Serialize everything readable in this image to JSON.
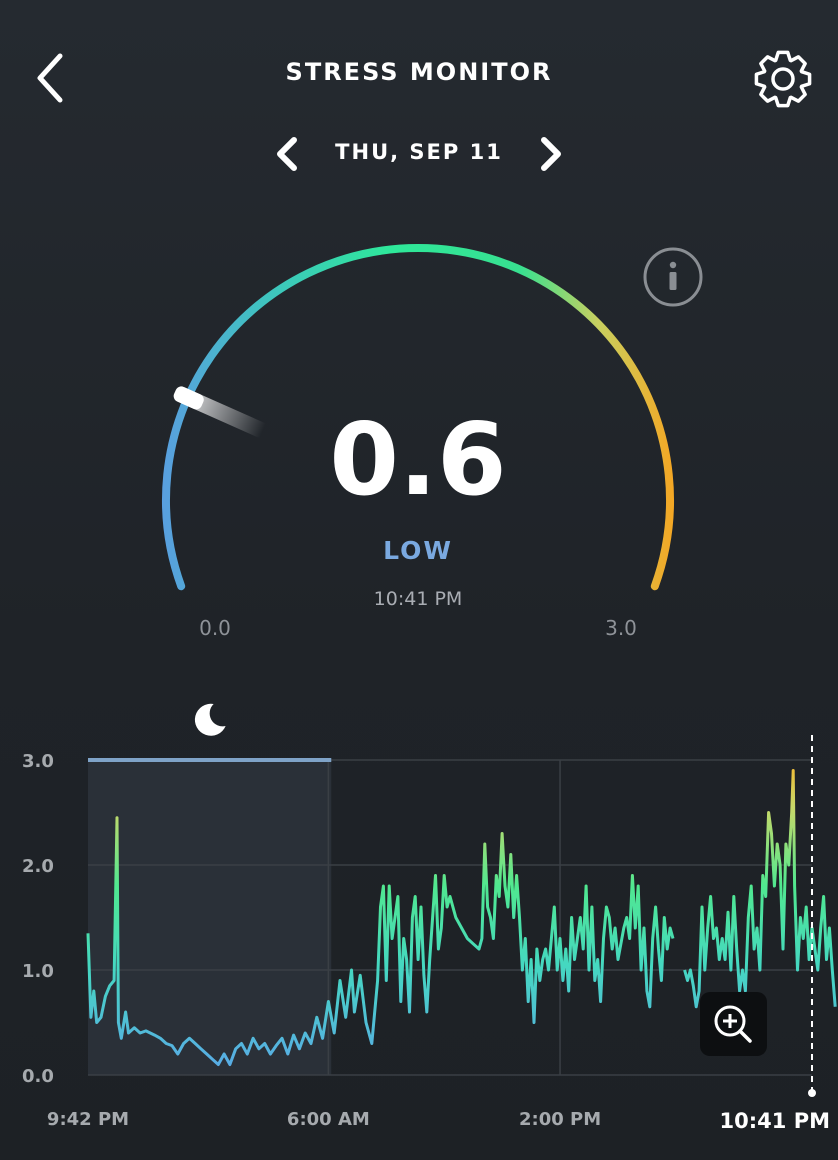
{
  "header": {
    "title": "STRESS MONITOR",
    "back_icon": "chevron-left-icon",
    "settings_icon": "gear-icon"
  },
  "date_nav": {
    "label": "THU, SEP 11",
    "prev_icon": "chevron-left-icon",
    "next_icon": "chevron-right-icon"
  },
  "gauge": {
    "value": "0.6",
    "level": "LOW",
    "time": "10:41 PM",
    "min_label": "0.0",
    "max_label": "3.0",
    "min": 0,
    "max": 3,
    "current": 0.6,
    "info_icon": "info-icon",
    "colors": {
      "low": "#5aa0e0",
      "mid": "#2ee89a",
      "high": "#f5a623",
      "level_text": "#7aa9e0"
    }
  },
  "chart_data": {
    "type": "line",
    "sleep_icon": "moon-icon",
    "zoom_icon": "zoom-in-icon",
    "ylim": [
      0,
      3
    ],
    "y_ticks": [
      "0.0",
      "1.0",
      "2.0",
      "3.0"
    ],
    "x_ticks": [
      "9:42 PM",
      "6:00 AM",
      "2:00 PM"
    ],
    "current_label": "10:41 PM",
    "x_range_hours": [
      0,
      25
    ],
    "sleep_period_hours": [
      0,
      8.4
    ],
    "grid": true,
    "series": [
      {
        "values": [
          [
            0.0,
            1.35
          ],
          [
            0.1,
            0.55
          ],
          [
            0.2,
            0.8
          ],
          [
            0.3,
            0.5
          ],
          [
            0.45,
            0.55
          ],
          [
            0.6,
            0.75
          ],
          [
            0.75,
            0.85
          ],
          [
            0.9,
            0.9
          ],
          [
            1.0,
            2.45
          ],
          [
            1.05,
            0.5
          ],
          [
            1.15,
            0.35
          ],
          [
            1.3,
            0.6
          ],
          [
            1.4,
            0.4
          ],
          [
            1.6,
            0.45
          ],
          [
            1.8,
            0.4
          ],
          [
            2.0,
            0.42
          ],
          [
            2.3,
            0.38
          ],
          [
            2.5,
            0.35
          ],
          [
            2.7,
            0.3
          ],
          [
            2.9,
            0.28
          ],
          [
            3.1,
            0.2
          ],
          [
            3.3,
            0.3
          ],
          [
            3.5,
            0.35
          ],
          [
            3.7,
            0.3
          ],
          [
            3.9,
            0.25
          ],
          [
            4.1,
            0.2
          ],
          [
            4.3,
            0.15
          ],
          [
            4.5,
            0.1
          ],
          [
            4.7,
            0.2
          ],
          [
            4.9,
            0.1
          ],
          [
            5.1,
            0.25
          ],
          [
            5.3,
            0.3
          ],
          [
            5.5,
            0.2
          ],
          [
            5.7,
            0.35
          ],
          [
            5.9,
            0.25
          ],
          [
            6.1,
            0.3
          ],
          [
            6.3,
            0.2
          ],
          [
            6.5,
            0.28
          ],
          [
            6.7,
            0.35
          ],
          [
            6.9,
            0.2
          ],
          [
            7.1,
            0.38
          ],
          [
            7.3,
            0.25
          ],
          [
            7.5,
            0.4
          ],
          [
            7.7,
            0.3
          ],
          [
            7.9,
            0.55
          ],
          [
            8.1,
            0.35
          ],
          [
            8.3,
            0.7
          ],
          [
            8.5,
            0.4
          ],
          [
            8.7,
            0.9
          ],
          [
            8.9,
            0.55
          ],
          [
            9.1,
            1.0
          ],
          [
            9.2,
            0.6
          ],
          [
            9.4,
            0.95
          ],
          [
            9.6,
            0.5
          ],
          [
            9.8,
            0.3
          ],
          [
            10.0,
            0.9
          ],
          [
            10.1,
            1.6
          ],
          [
            10.2,
            1.8
          ],
          [
            10.3,
            0.9
          ],
          [
            10.4,
            1.8
          ],
          [
            10.5,
            1.3
          ],
          [
            10.6,
            1.5
          ],
          [
            10.7,
            1.7
          ],
          [
            10.8,
            0.7
          ],
          [
            10.9,
            1.3
          ],
          [
            11.0,
            1.1
          ],
          [
            11.1,
            0.6
          ],
          [
            11.2,
            1.5
          ],
          [
            11.3,
            1.7
          ],
          [
            11.4,
            1.1
          ],
          [
            11.5,
            1.6
          ],
          [
            11.6,
            0.95
          ],
          [
            11.7,
            0.6
          ],
          [
            11.8,
            1.1
          ],
          [
            11.9,
            1.5
          ],
          [
            12.0,
            1.9
          ],
          [
            12.1,
            1.2
          ],
          [
            12.2,
            1.4
          ],
          [
            12.3,
            1.9
          ],
          [
            12.4,
            1.6
          ],
          [
            12.5,
            1.7
          ],
          [
            12.7,
            1.5
          ],
          [
            12.9,
            1.4
          ],
          [
            13.1,
            1.3
          ],
          [
            13.3,
            1.25
          ],
          [
            13.5,
            1.2
          ],
          [
            13.6,
            1.3
          ],
          [
            13.7,
            2.2
          ],
          [
            13.8,
            1.6
          ],
          [
            13.9,
            1.5
          ],
          [
            14.0,
            1.3
          ],
          [
            14.1,
            1.9
          ],
          [
            14.2,
            1.7
          ],
          [
            14.3,
            2.3
          ],
          [
            14.4,
            1.8
          ],
          [
            14.5,
            1.6
          ],
          [
            14.6,
            2.1
          ],
          [
            14.7,
            1.5
          ],
          [
            14.8,
            1.9
          ],
          [
            14.9,
            1.5
          ],
          [
            15.0,
            1.0
          ],
          [
            15.1,
            1.3
          ],
          [
            15.2,
            0.7
          ],
          [
            15.3,
            1.1
          ],
          [
            15.4,
            0.5
          ],
          [
            15.5,
            1.2
          ],
          [
            15.6,
            0.9
          ],
          [
            15.7,
            1.1
          ],
          [
            15.8,
            1.2
          ],
          [
            15.9,
            1.0
          ],
          [
            16.0,
            1.3
          ],
          [
            16.1,
            1.6
          ],
          [
            16.2,
            1.0
          ],
          [
            16.3,
            1.3
          ],
          [
            16.4,
            0.9
          ],
          [
            16.5,
            1.2
          ],
          [
            16.6,
            0.8
          ],
          [
            16.7,
            1.5
          ],
          [
            16.8,
            1.1
          ],
          [
            16.9,
            1.3
          ],
          [
            17.0,
            1.5
          ],
          [
            17.1,
            1.2
          ],
          [
            17.2,
            1.8
          ],
          [
            17.3,
            1.0
          ],
          [
            17.4,
            1.6
          ],
          [
            17.5,
            0.9
          ],
          [
            17.6,
            1.1
          ],
          [
            17.7,
            0.7
          ],
          [
            17.8,
            1.3
          ],
          [
            17.9,
            1.6
          ],
          [
            18.0,
            1.5
          ],
          [
            18.1,
            1.2
          ],
          [
            18.2,
            1.4
          ],
          [
            18.3,
            1.1
          ],
          [
            18.5,
            1.4
          ],
          [
            18.6,
            1.5
          ],
          [
            18.7,
            1.3
          ],
          [
            18.8,
            1.9
          ],
          [
            18.9,
            1.4
          ],
          [
            19.0,
            1.8
          ],
          [
            19.1,
            1.0
          ],
          [
            19.2,
            1.4
          ],
          [
            19.3,
            0.8
          ],
          [
            19.4,
            0.65
          ],
          [
            19.5,
            1.3
          ],
          [
            19.6,
            1.6
          ],
          [
            19.7,
            1.2
          ],
          [
            19.8,
            0.9
          ],
          [
            19.9,
            1.5
          ],
          [
            20.0,
            1.2
          ],
          [
            20.1,
            1.4
          ],
          [
            20.2,
            1.3
          ]
        ]
      },
      {
        "values": [
          [
            20.6,
            1.0
          ],
          [
            20.7,
            0.9
          ],
          [
            20.8,
            1.0
          ],
          [
            20.9,
            0.85
          ],
          [
            21.0,
            0.65
          ],
          [
            21.1,
            0.8
          ],
          [
            21.2,
            1.6
          ],
          [
            21.3,
            1.0
          ],
          [
            21.4,
            1.4
          ],
          [
            21.5,
            1.7
          ],
          [
            21.6,
            1.3
          ],
          [
            21.7,
            1.4
          ],
          [
            21.8,
            1.1
          ],
          [
            21.9,
            1.3
          ],
          [
            22.0,
            1.1
          ],
          [
            22.1,
            1.55
          ],
          [
            22.2,
            1.0
          ],
          [
            22.3,
            1.7
          ],
          [
            22.4,
            1.2
          ],
          [
            22.5,
            0.8
          ],
          [
            22.6,
            1.0
          ],
          [
            22.7,
            0.8
          ],
          [
            22.8,
            1.5
          ],
          [
            22.9,
            1.8
          ],
          [
            23.0,
            1.2
          ],
          [
            23.1,
            1.4
          ],
          [
            23.2,
            1.0
          ],
          [
            23.3,
            1.9
          ],
          [
            23.4,
            1.7
          ],
          [
            23.5,
            2.5
          ],
          [
            23.6,
            2.3
          ],
          [
            23.7,
            1.8
          ],
          [
            23.8,
            2.2
          ],
          [
            23.9,
            2.0
          ],
          [
            24.0,
            1.2
          ],
          [
            24.1,
            2.2
          ],
          [
            24.2,
            2.0
          ],
          [
            24.3,
            2.5
          ],
          [
            24.35,
            2.9
          ],
          [
            24.4,
            1.8
          ],
          [
            24.5,
            1.0
          ],
          [
            24.6,
            1.5
          ],
          [
            24.7,
            1.3
          ],
          [
            24.8,
            1.6
          ],
          [
            24.9,
            1.1
          ],
          [
            25.0,
            1.4
          ],
          [
            25.1,
            1.2
          ],
          [
            25.2,
            1.0
          ],
          [
            25.3,
            1.4
          ],
          [
            25.4,
            1.7
          ],
          [
            25.5,
            1.1
          ],
          [
            25.6,
            1.4
          ],
          [
            25.7,
            1.0
          ],
          [
            25.8,
            0.65
          ]
        ]
      }
    ],
    "colors": {
      "grid": "#3a3f45",
      "sleep_band": "#2a3038",
      "sleep_bar": "#7fa3c8",
      "axis_text": "#a6aaae"
    }
  }
}
